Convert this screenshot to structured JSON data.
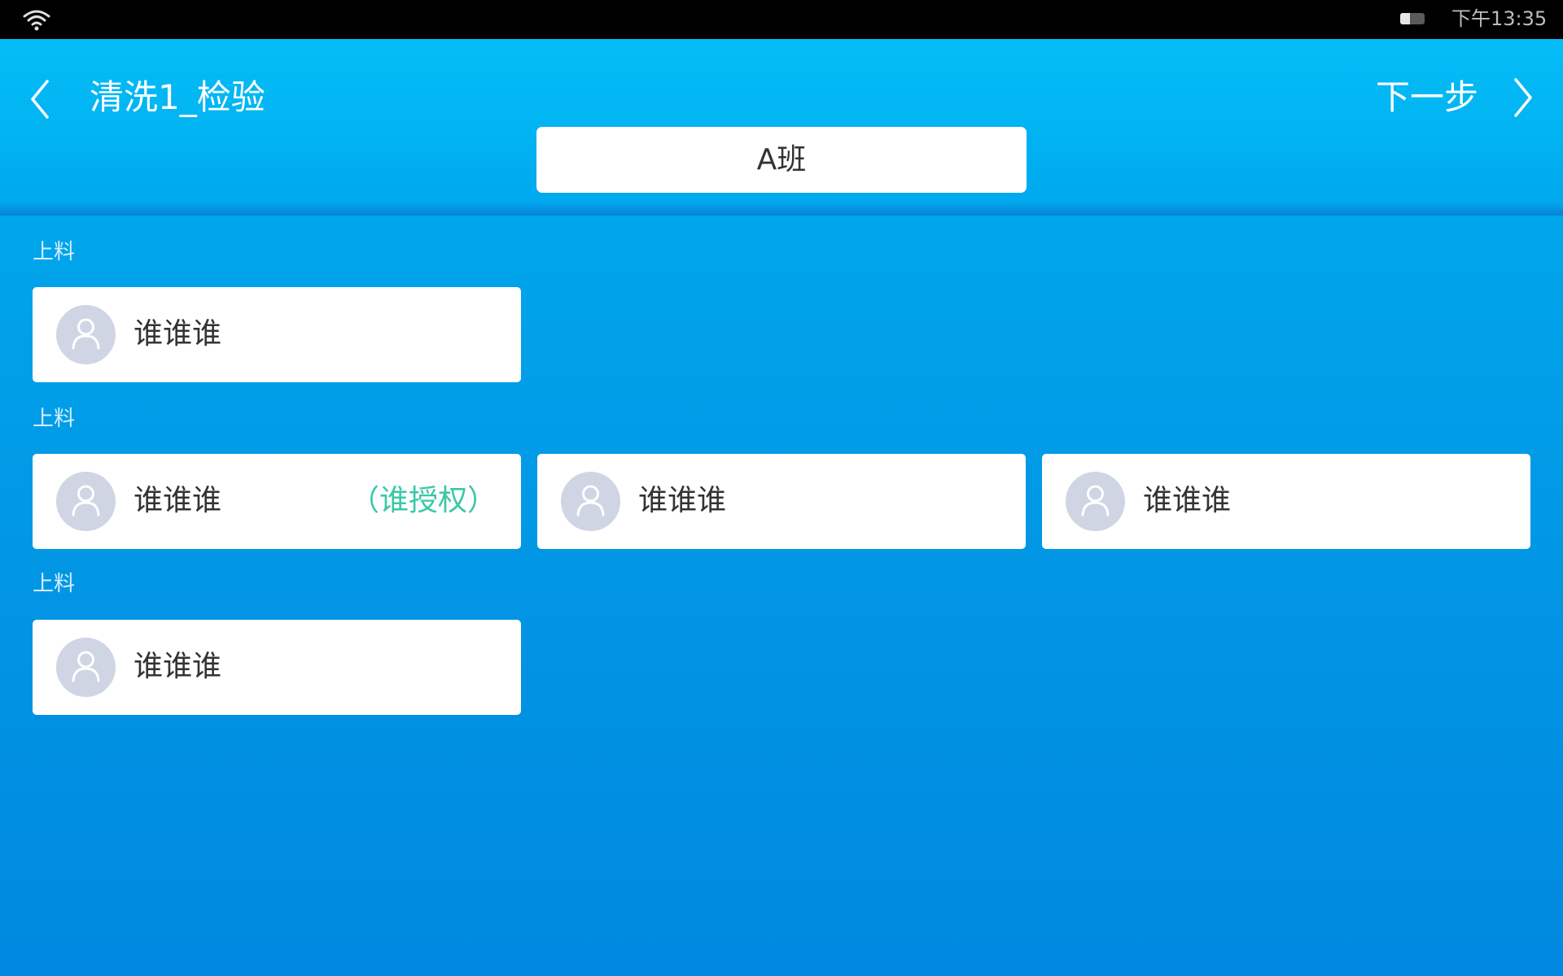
{
  "status_bar": {
    "time": "下午13:35",
    "battery_level": 0.4,
    "icons": [
      "wifi-icon",
      "battery-icon"
    ]
  },
  "header": {
    "title": "清洗1_检验",
    "next_label": "下一步",
    "shift": "A班",
    "icons": [
      "chevron-left-icon",
      "chevron-right-icon"
    ]
  },
  "sections": [
    {
      "label": "上料",
      "cards": [
        {
          "name": "谁谁谁",
          "note": ""
        }
      ]
    },
    {
      "label": "上料",
      "cards": [
        {
          "name": "谁谁谁",
          "note": "（谁授权）"
        },
        {
          "name": "谁谁谁",
          "note": ""
        },
        {
          "name": "谁谁谁",
          "note": ""
        }
      ]
    },
    {
      "label": "上料",
      "cards": [
        {
          "name": "谁谁谁",
          "note": ""
        }
      ]
    }
  ],
  "colors": {
    "header_top": "#04bdf7",
    "content_bottom": "#0088e0",
    "auth_note": "#39c8a6",
    "avatar_bg": "#cfd5e3"
  }
}
